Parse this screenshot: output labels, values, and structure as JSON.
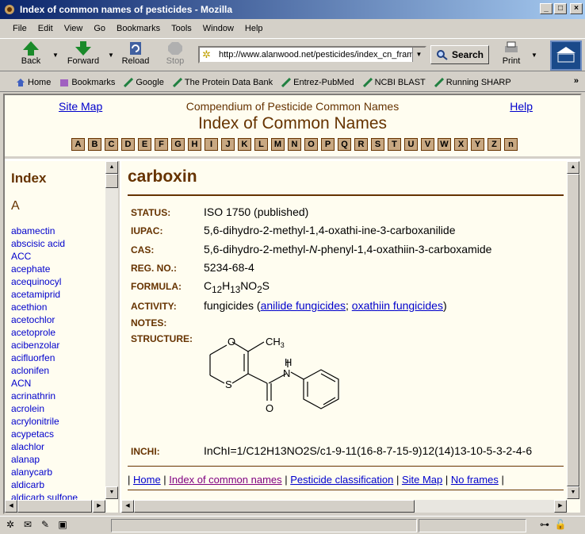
{
  "window": {
    "title": "Index of common names of pesticides - Mozilla"
  },
  "menu": [
    "File",
    "Edit",
    "View",
    "Go",
    "Bookmarks",
    "Tools",
    "Window",
    "Help"
  ],
  "nav": {
    "back": "Back",
    "forward": "Forward",
    "reload": "Reload",
    "stop": "Stop",
    "print": "Print",
    "search": "Search",
    "url": "http://www.alanwood.net/pesticides/index_cn_frame.html"
  },
  "bookmarks": [
    "Home",
    "Bookmarks",
    "Google",
    "The Protein Data Bank",
    "Entrez-PubMed",
    "NCBI BLAST",
    "Running SHARP"
  ],
  "header": {
    "site_map": "Site Map",
    "help": "Help",
    "compendium": "Compendium of Pesticide Common Names",
    "title": "Index of Common Names",
    "letters": [
      "A",
      "B",
      "C",
      "D",
      "E",
      "F",
      "G",
      "H",
      "I",
      "J",
      "K",
      "L",
      "M",
      "N",
      "O",
      "P",
      "Q",
      "R",
      "S",
      "T",
      "U",
      "V",
      "W",
      "X",
      "Y",
      "Z",
      "n"
    ]
  },
  "index": {
    "heading": "Index",
    "letter": "A",
    "items": [
      "abamectin",
      "abscisic acid",
      "ACC",
      "acephate",
      "acequinocyl",
      "acetamiprid",
      "acethion",
      "acetochlor",
      "acetoprole",
      "acibenzolar",
      "acifluorfen",
      "aclonifen",
      "ACN",
      "acrinathrin",
      "acrolein",
      "acrylonitrile",
      "acypetacs",
      "alachlor",
      "alanap",
      "alanycarb",
      "aldicarb",
      "aldicarb sulfone"
    ]
  },
  "compound": {
    "name": "carboxin",
    "status_label": "STATUS:",
    "status": "ISO 1750 (published)",
    "iupac_label": "IUPAC:",
    "iupac": "5,6-dihydro-2-methyl-1,4-oxathi-ine-3-carboxanilide",
    "cas_label": "CAS:",
    "cas_a": "5,6-dihydro-2-methyl-",
    "cas_n": "N",
    "cas_b": "-phenyl-1,4-oxathiin-3-carboxamide",
    "reg_label": "REG. NO.:",
    "reg": "5234-68-4",
    "formula_label": "FORMULA:",
    "activity_label": "ACTIVITY:",
    "activity_pre": "fungicides (",
    "activity_link1": "anilide fungicides",
    "activity_sep": "; ",
    "activity_link2": "oxathiin fungicides",
    "activity_post": ")",
    "notes_label": "NOTES:",
    "structure_label": "STRUCTURE:",
    "struct_atoms": {
      "o": "O",
      "ch3": "CH3",
      "h": "H",
      "n": "N",
      "s": "S",
      "o2": "O"
    },
    "inchi_label": "INCHI:",
    "inchi": "InChI=1/C12H13NO2S/c1-9-11(16-8-7-15-9)12(14)13-10-5-3-2-4-6"
  },
  "footer": {
    "home": "Home",
    "index": "Index of common names",
    "classification": "Pesticide classification",
    "sitemap": "Site Map",
    "noframes": "No frames"
  }
}
